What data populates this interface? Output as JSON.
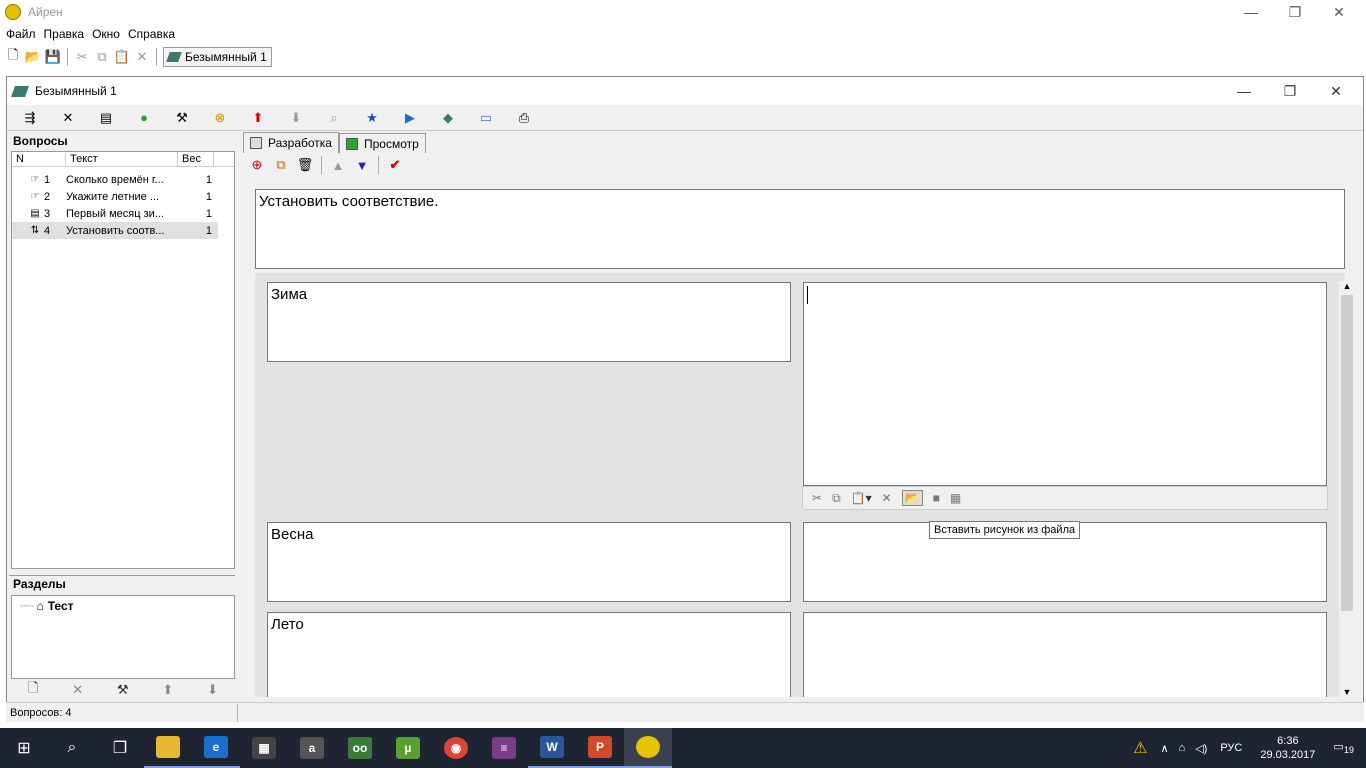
{
  "app": {
    "title": "Айрен"
  },
  "menu": [
    "Файл",
    "Правка",
    "Окно",
    "Справка"
  ],
  "toolbar1": {
    "window_tab": "Безымянный 1"
  },
  "child": {
    "title": "Безымянный 1"
  },
  "left": {
    "questions_header": "Вопросы",
    "columns": [
      "N",
      "Текст",
      "Вес"
    ],
    "rows": [
      {
        "n": "1",
        "text": "Сколько времён г...",
        "w": "1"
      },
      {
        "n": "2",
        "text": "Укажите летние ...",
        "w": "1"
      },
      {
        "n": "3",
        "text": "Первый месяц зи...",
        "w": "1"
      },
      {
        "n": "4",
        "text": "Установить соотв...",
        "w": "1"
      }
    ],
    "sections_header": "Разделы",
    "section_item": "Тест"
  },
  "right": {
    "tabs": [
      "Разработка",
      "Просмотр"
    ],
    "question_text": "Установить соответствие.",
    "pairs": [
      {
        "left": "Зима",
        "right": ""
      },
      {
        "left": "Весна",
        "right": ""
      },
      {
        "left": "Лето",
        "right": ""
      }
    ],
    "tooltip": "Вставить рисунок из файла"
  },
  "status": {
    "count": "Вопросов: 4"
  },
  "taskbar": {
    "lang": "РУС",
    "time": "6:36",
    "date": "29.03.2017",
    "notif": "19"
  },
  "colors": {
    "accent": "#3a7a6e",
    "taskbar": "#1f2433"
  }
}
